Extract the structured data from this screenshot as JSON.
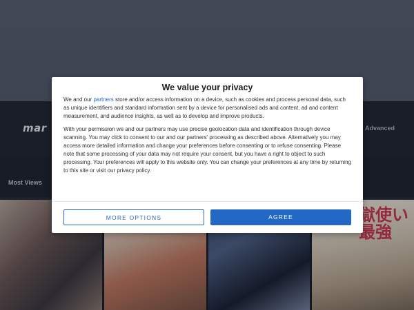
{
  "site": {
    "logo": "mar",
    "nav_advanced": "Advanced",
    "section_label": "Most Views",
    "cover_text_1": "",
    "cover_text_4": "獄使い\n最強"
  },
  "privacy_dialog": {
    "title": "We value your privacy",
    "paragraph1_before_link": "We and our ",
    "paragraph1_link": "partners",
    "paragraph1_after_link": " store and/or access information on a device, such as cookies and process personal data, such as unique identifiers and standard information sent by a device for personalised ads and content, ad and content measurement, and audience insights, as well as to develop and improve products.",
    "paragraph2": "With your permission we and our partners may use precise geolocation data and identification through device scanning. You may click to consent to our and our partners’ processing as described above. Alternatively you may access more detailed information and change your preferences before consenting or to refuse consenting. Please note that some processing of your data may not require your consent, but you have a right to object to such processing. Your preferences will apply to this website only. You can change your preferences at any time by returning to this site or visit our privacy policy.",
    "more_options_label": "MORE OPTIONS",
    "agree_label": "AGREE"
  },
  "colors": {
    "accent": "#2368c4",
    "header_bg": "#242a38",
    "top_band": "#5a6577"
  }
}
